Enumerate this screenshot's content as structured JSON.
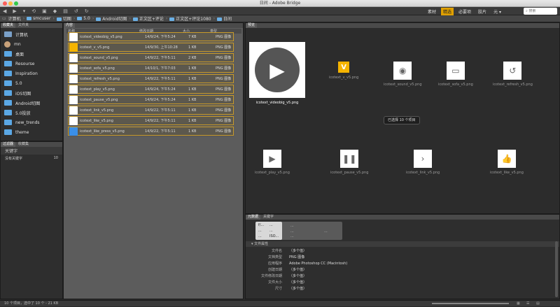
{
  "window": {
    "title": "日间 - Adobe Bridge"
  },
  "workspaces": [
    {
      "label": "素材",
      "active": false
    },
    {
      "label": "精选",
      "active": true
    },
    {
      "label": "必要项",
      "active": false
    },
    {
      "label": "胶片",
      "active": false
    },
    {
      "label": "元 ▾",
      "active": false
    }
  ],
  "search": {
    "placeholder": "搜索"
  },
  "path": [
    "计算机",
    "smcuser",
    "切图",
    "5.0",
    "Android切图",
    "正文区+评论",
    "正文区+评论1080",
    "日间"
  ],
  "panels": {
    "favorites_tab": "收藏夹",
    "folders_tab": "文件夹",
    "filter_tab": "过滤器",
    "collections_tab": "收藏集",
    "content_tab": "内容",
    "preview_tab": "预览",
    "metadata_tab": "元数据",
    "keywords_tab": "关键字"
  },
  "favorites": [
    "计算机",
    "mn",
    "桌面",
    "Resourse",
    "Inspiration",
    "5.0",
    "iOS切图",
    "Android切图",
    "5.0投放",
    "new_trends",
    "theme"
  ],
  "filter": {
    "header": "关键字",
    "row_label": "没有关键字",
    "row_count": "10"
  },
  "list_headers": {
    "name": "名称",
    "date": "修改日期",
    "size": "大小",
    "type": "类型"
  },
  "files": [
    {
      "name": "icotext_videobig_v5.png",
      "date": "14/9/24, 下午5:24",
      "size": "7 KB",
      "type": "PNG 图像"
    },
    {
      "name": "icotext_v_v5.png",
      "date": "14/9/30, 上午10:28",
      "size": "1 KB",
      "type": "PNG 图像"
    },
    {
      "name": "icotext_sound_v5.png",
      "date": "14/9/22, 下午5:11",
      "size": "2 KB",
      "type": "PNG 图像"
    },
    {
      "name": "icotext_sofa_v5.png",
      "date": "14/10/1, 下午7:03",
      "size": "1 KB",
      "type": "PNG 图像"
    },
    {
      "name": "icotext_refresh_v5.png",
      "date": "14/9/22, 下午5:11",
      "size": "1 KB",
      "type": "PNG 图像"
    },
    {
      "name": "icotext_play_v5.png",
      "date": "14/9/24, 下午5:24",
      "size": "1 KB",
      "type": "PNG 图像"
    },
    {
      "name": "icotext_pause_v5.png",
      "date": "14/9/24, 下午5:24",
      "size": "1 KB",
      "type": "PNG 图像"
    },
    {
      "name": "icotext_link_v5.png",
      "date": "14/9/22, 下午5:11",
      "size": "1 KB",
      "type": "PNG 图像"
    },
    {
      "name": "icotext_like_v5.png",
      "date": "14/9/22, 下午5:11",
      "size": "1 KB",
      "type": "PNG 图像"
    },
    {
      "name": "icotext_like_press_v5.png",
      "date": "14/9/22, 下午5:11",
      "size": "1 KB",
      "type": "PNG 图像"
    }
  ],
  "thumbs": [
    "icotext_videobig_v5.png",
    "icotext_v_v5.png",
    "icotext_sound_v5.png",
    "icotext_sofa_v5.png",
    "icotext_refresh_v5.png",
    "icotext_play_v5.png",
    "icotext_pause_v5.png",
    "icotext_link_v5.png",
    "icotext_like_v5.png"
  ],
  "selection_badge": "已选择 10 个项目",
  "metadata": {
    "section": "文件属性",
    "rows": [
      {
        "k": "文件名",
        "v": "（多个值）"
      },
      {
        "k": "文档类型",
        "v": "PNG 图像"
      },
      {
        "k": "应用程序",
        "v": "Adobe Photoshop CC (Macintosh)"
      },
      {
        "k": "创建日期",
        "v": "（多个值）"
      },
      {
        "k": "文件修改日期",
        "v": "（多个值）"
      },
      {
        "k": "文件大小",
        "v": "（多个值）"
      },
      {
        "k": "尺寸",
        "v": "（多个值）"
      }
    ],
    "placeholders": [
      "f/...",
      "...",
      "...",
      "...",
      "...",
      "...",
      "ISO..."
    ]
  },
  "status": "10 个项目，选中了 10 个 - 21 KB",
  "colors": {
    "accent": "#e0a000",
    "folder": "#5ba8e5",
    "selected_row": "#5c584d"
  }
}
